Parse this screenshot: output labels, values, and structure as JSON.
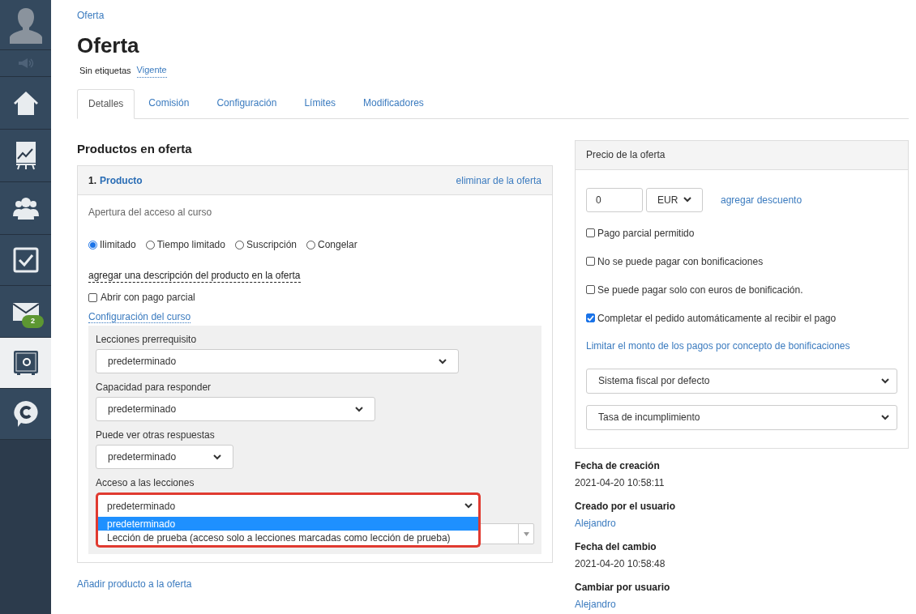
{
  "sidebar": {
    "items": [
      {
        "kind": "avatar",
        "selected": false
      },
      {
        "kind": "speaker",
        "selected": false
      },
      {
        "kind": "home",
        "selected": false
      },
      {
        "kind": "chart",
        "selected": false
      },
      {
        "kind": "people",
        "selected": false
      },
      {
        "kind": "check",
        "selected": false
      },
      {
        "kind": "mail",
        "selected": false,
        "badge": "2"
      },
      {
        "kind": "safe",
        "selected": true
      },
      {
        "kind": "chat",
        "selected": false
      }
    ]
  },
  "breadcrumb": "Oferta",
  "title": "Oferta",
  "tags": {
    "label": "Sin etiquetas",
    "status": "Vigente"
  },
  "tabs": [
    {
      "label": "Detalles",
      "selected": true
    },
    {
      "label": "Comisión",
      "selected": false
    },
    {
      "label": "Configuración",
      "selected": false
    },
    {
      "label": "Límites",
      "selected": false
    },
    {
      "label": "Modificadores",
      "selected": false
    }
  ],
  "products": {
    "heading": "Productos en oferta",
    "number": "1.",
    "product": "Producto",
    "remove": "eliminar de la oferta",
    "access_label": "Apertura del acceso al curso",
    "access_options": [
      {
        "label": "Ilimitado",
        "selected": true
      },
      {
        "label": "Tiempo limitado",
        "selected": false
      },
      {
        "label": "Suscripción",
        "selected": false
      },
      {
        "label": "Congelar",
        "selected": false
      }
    ],
    "add_description": "agregar una descripción del producto en la oferta",
    "partial_checkbox": {
      "label": "Abrir con pago parcial",
      "checked": false
    },
    "course_settings": "Configuración del curso",
    "settings": [
      {
        "label": "Lecciones prerrequisito",
        "value": "predeterminado"
      },
      {
        "label": "Capacidad para responder",
        "value": "predeterminado"
      },
      {
        "label": "Puede ver otras respuestas",
        "value": "predeterminado"
      },
      {
        "label": "Acceso a las lecciones",
        "value": "predeterminado",
        "open": true,
        "options": [
          {
            "label": "predeterminado",
            "selected": true
          },
          {
            "label": "Lección de prueba (acceso solo a lecciones marcadas como lección de prueba)",
            "selected": false
          }
        ]
      }
    ],
    "add_product": "Añadir producto a la oferta"
  },
  "price": {
    "heading": "Precio de la oferta",
    "amount": "0",
    "currency": "EUR",
    "discount": "agregar descuento",
    "options": [
      {
        "label": "Pago parcial permitido",
        "checked": false
      },
      {
        "label": "No se puede pagar con bonificaciones",
        "checked": false
      },
      {
        "label": "Se puede pagar solo con euros de bonificación.",
        "checked": false
      },
      {
        "label": "Completar el pedido automáticamente al recibir el pago",
        "checked": true
      }
    ],
    "limit_link": "Limitar el monto de los pagos por concepto de bonificaciones",
    "tax_system": "Sistema fiscal por defecto",
    "tax_rate": "Tasa de incumplimiento"
  },
  "meta": [
    {
      "label": "Fecha de creación",
      "value": "2021-04-20 10:58:11",
      "kind": "text"
    },
    {
      "label": "Creado por el usuario",
      "value": "Alejandro",
      "kind": "link"
    },
    {
      "label": "Fecha del cambio",
      "value": "2021-04-20 10:58:48",
      "kind": "text"
    },
    {
      "label": "Cambiar por usuario",
      "value": "Alejandro",
      "kind": "link"
    }
  ]
}
